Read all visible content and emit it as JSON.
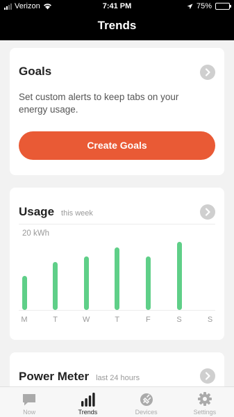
{
  "status_bar": {
    "carrier": "Verizon",
    "time": "7:41 PM",
    "battery": "75%",
    "battery_level": 0.75
  },
  "header": {
    "title": "Trends"
  },
  "goals": {
    "title": "Goals",
    "description": "Set custom alerts to keep tabs on your energy usage.",
    "button_label": "Create Goals"
  },
  "usage": {
    "title": "Usage",
    "subtitle": "this week"
  },
  "chart_data": {
    "type": "bar",
    "categories": [
      "M",
      "T",
      "W",
      "T",
      "F",
      "S",
      "S"
    ],
    "values": [
      12,
      17,
      19,
      22,
      19,
      24,
      0
    ],
    "unit": "kWh",
    "ytick": "20 kWh",
    "ylim": [
      0,
      26
    ],
    "grid": false,
    "colors": {
      "bar": "#5fcf88"
    }
  },
  "power_meter": {
    "title": "Power Meter",
    "subtitle": "last 24 hours"
  },
  "tabs": [
    {
      "label": "Now",
      "icon": "chat-bubble-icon",
      "active": false
    },
    {
      "label": "Trends",
      "icon": "bar-chart-icon",
      "active": true
    },
    {
      "label": "Devices",
      "icon": "plug-icon",
      "active": false
    },
    {
      "label": "Settings",
      "icon": "gear-icon",
      "active": false
    }
  ],
  "colors": {
    "accent": "#e95a35",
    "bar": "#5fcf88",
    "nav_bg": "#000000"
  }
}
